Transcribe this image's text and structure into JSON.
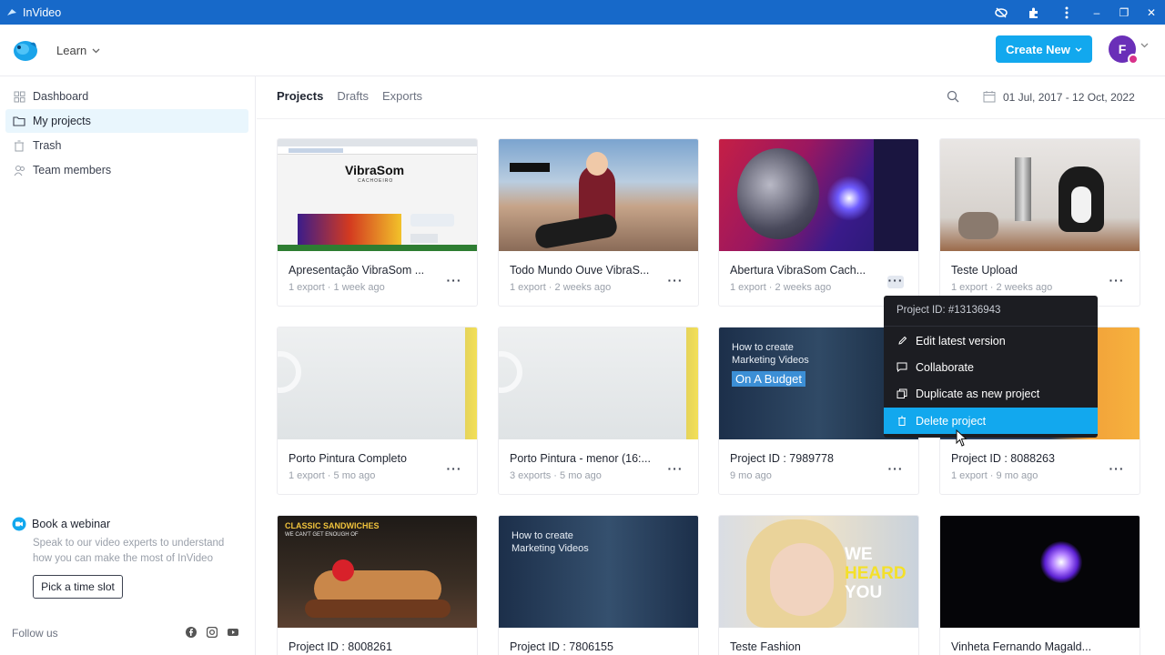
{
  "window": {
    "title": "InVideo",
    "controls": [
      "–",
      "❐",
      "✕"
    ]
  },
  "header": {
    "learn_label": "Learn",
    "create_label": "Create New",
    "avatar_letter": "F"
  },
  "sidebar": {
    "items": [
      {
        "label": "Dashboard",
        "icon": "dashboard-icon"
      },
      {
        "label": "My projects",
        "icon": "folder-icon",
        "active": true
      },
      {
        "label": "Trash",
        "icon": "trash-icon"
      },
      {
        "label": "Team members",
        "icon": "team-icon"
      }
    ],
    "webinar_title": "Book a webinar",
    "webinar_text": "Speak to our video experts to understand how you can make the most of InVideo",
    "slot_label": "Pick a time slot",
    "follow_label": "Follow us"
  },
  "main": {
    "tabs": [
      "Projects",
      "Drafts",
      "Exports"
    ],
    "date_range": "01 Jul, 2017 - 12 Oct, 2022",
    "projects": [
      {
        "title": "Apresentação VibraSom ...",
        "meta": "1 export · 1 week ago",
        "thumb_text": "VibraSom",
        "thumb_sub": "CACHOEIRO"
      },
      {
        "title": "Todo Mundo Ouve VibraS...",
        "meta": "1 export · 2 weeks ago"
      },
      {
        "title": "Abertura VibraSom Cach...",
        "meta": "1 export · 2 weeks ago"
      },
      {
        "title": "Teste Upload",
        "meta": "1 export · 2 weeks ago"
      },
      {
        "title": "Porto Pintura Completo",
        "meta": "1 export · 5 mo ago"
      },
      {
        "title": "Porto Pintura - menor (16:...",
        "meta": "3 exports · 5 mo ago"
      },
      {
        "title": "Project ID : 7989778",
        "meta": "9 mo ago",
        "thumb_line1": "How to create",
        "thumb_line2": "Marketing Videos",
        "thumb_line3": "On A Budget"
      },
      {
        "title": "Project ID : 8088263",
        "meta": "1 export · 9 mo ago"
      },
      {
        "title": "Project ID : 8008261",
        "meta": "",
        "thumb_line1": "CLASSIC SANDWICHES",
        "thumb_line2": "WE CAN'T GET ENOUGH OF"
      },
      {
        "title": "Project ID : 7806155",
        "meta": "",
        "thumb_line1": "How to create",
        "thumb_line2": "Marketing Videos"
      },
      {
        "title": "Teste Fashion",
        "meta": "",
        "thumb_line1": "WE",
        "thumb_line2": "HEARD",
        "thumb_line3": "YOU"
      },
      {
        "title": "Vinheta Fernando Magald...",
        "meta": ""
      }
    ],
    "more_label": "···"
  },
  "context_menu": {
    "project_id": "Project ID: #13136943",
    "items": [
      {
        "label": "Edit latest version",
        "icon": "pencil-icon"
      },
      {
        "label": "Collaborate",
        "icon": "comment-icon"
      },
      {
        "label": "Duplicate as new project",
        "icon": "duplicate-icon"
      },
      {
        "label": "Delete project",
        "icon": "trash-icon",
        "highlighted": true
      }
    ]
  },
  "colors": {
    "titlebar": "#1769c9",
    "accent": "#12a8ee",
    "avatar": "#6a2fb8",
    "menu_bg": "#1c1d22"
  }
}
